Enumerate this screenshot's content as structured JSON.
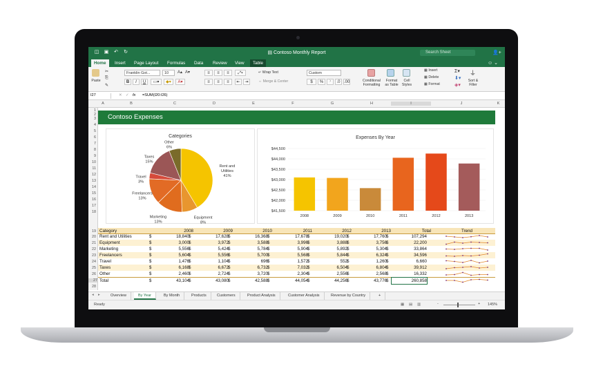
{
  "window": {
    "title": "Contoso Monthly Report",
    "search_placeholder": "Search Sheet"
  },
  "ribbon_tabs": [
    "Home",
    "Insert",
    "Page Layout",
    "Formulas",
    "Data",
    "Review",
    "View",
    "Table"
  ],
  "ribbon": {
    "paste": "Paste",
    "font_name": "Franklin Got...",
    "font_size": "10",
    "wrap_text": "Wrap Text",
    "merge_center": "Merge & Center",
    "number_format": "Custom",
    "conditional_formatting": "Conditional Formatting",
    "format_as_table": "Format as Table",
    "cell_styles": "Cell Styles",
    "insert": "Insert",
    "delete": "Delete",
    "format": "Format",
    "sort_filter": "Sort & Filter",
    "bold": "B",
    "italic": "I",
    "underline": "U",
    "currency": "$",
    "percent": "%"
  },
  "formula_bar": {
    "cell_ref": "I27",
    "fx": "fx",
    "formula": "=SUM(I20:I26)"
  },
  "columns": [
    "A",
    "B",
    "C",
    "D",
    "E",
    "F",
    "G",
    "H",
    "I",
    "J",
    "K"
  ],
  "rows": [
    "1",
    "2",
    "3",
    "4",
    "5",
    "6",
    "7",
    "8",
    "9",
    "10",
    "11",
    "12",
    "13",
    "14",
    "15",
    "16",
    "17",
    "18",
    "19",
    "20",
    "21",
    "22",
    "23",
    "24",
    "25",
    "26",
    "27",
    "28"
  ],
  "banner": "Contoso Expenses",
  "charts": {
    "pie_title": "Categories",
    "bar_title": "Expenses By Year"
  },
  "chart_data": [
    {
      "type": "pie",
      "title": "Categories",
      "categories": [
        "Rent and Utilities",
        "Equipment",
        "Marketing",
        "Freelancers",
        "Travel",
        "Taxes",
        "Other"
      ],
      "values": [
        41,
        8,
        13,
        13,
        3,
        15,
        6
      ],
      "labels": [
        "Rent and Utilities 41%",
        "Equipment 8%",
        "Marketing 13%",
        "Freelancers 13%",
        "Travel 3%",
        "Taxes 15%",
        "Other 6%"
      ],
      "colors": [
        "#f5c400",
        "#e8962f",
        "#e06c1e",
        "#e26b25",
        "#d64a3a",
        "#9b5656",
        "#7a6b2a"
      ]
    },
    {
      "type": "bar",
      "title": "Expenses By Year",
      "categories": [
        "2008",
        "2009",
        "2010",
        "2011",
        "2012",
        "2013"
      ],
      "values": [
        43104,
        43080,
        42588,
        44054,
        44256,
        43776
      ],
      "ylim": [
        41500,
        44500
      ],
      "yticks": [
        "$41,500",
        "$42,000",
        "$42,500",
        "$43,000",
        "$43,500",
        "$44,000",
        "$44,500"
      ],
      "colors": [
        "#f5c400",
        "#f2a51d",
        "#c98a3a",
        "#e8651e",
        "#e5491a",
        "#a45b5b"
      ]
    }
  ],
  "table": {
    "headers": [
      "Category",
      "2008",
      "2009",
      "2010",
      "2011",
      "2012",
      "2013",
      "Total",
      "Trend"
    ],
    "rows": [
      {
        "label": "Rent and Utilities",
        "values": [
          "18,840",
          "17,628",
          "16,368",
          "17,678",
          "19,020",
          "17,760",
          "107,294"
        ]
      },
      {
        "label": "Equipment",
        "values": [
          "3,000",
          "3,972",
          "3,588",
          "3,996",
          "3,888",
          "3,756",
          "22,200"
        ]
      },
      {
        "label": "Marketing",
        "values": [
          "5,556",
          "5,424",
          "5,784",
          "5,904",
          "5,892",
          "5,304",
          "33,864"
        ]
      },
      {
        "label": "Freelancers",
        "values": [
          "5,604",
          "5,556",
          "5,700",
          "5,568",
          "5,844",
          "6,324",
          "34,596"
        ]
      },
      {
        "label": "Travel",
        "values": [
          "1,476",
          "1,104",
          "696",
          "1,572",
          "552",
          "1,260",
          "6,660"
        ]
      },
      {
        "label": "Taxes",
        "values": [
          "6,168",
          "6,672",
          "6,732",
          "7,032",
          "6,504",
          "6,804",
          "39,912"
        ]
      },
      {
        "label": "Other",
        "values": [
          "2,460",
          "2,724",
          "3,720",
          "2,304",
          "2,556",
          "2,568",
          "16,332"
        ]
      },
      {
        "label": "Total",
        "values": [
          "43,104",
          "43,080",
          "42,588",
          "44,054",
          "44,256",
          "43,776",
          "260,858"
        ]
      }
    ],
    "currency": "$"
  },
  "sheet_tabs": [
    "Overview",
    "By Year",
    "By Month",
    "Products",
    "Customers",
    "Product Analysis",
    "Customer Analysis",
    "Revenue by Country"
  ],
  "add_sheet": "+",
  "status": {
    "ready": "Ready",
    "zoom": "145%",
    "minus": "-",
    "plus": "+"
  }
}
